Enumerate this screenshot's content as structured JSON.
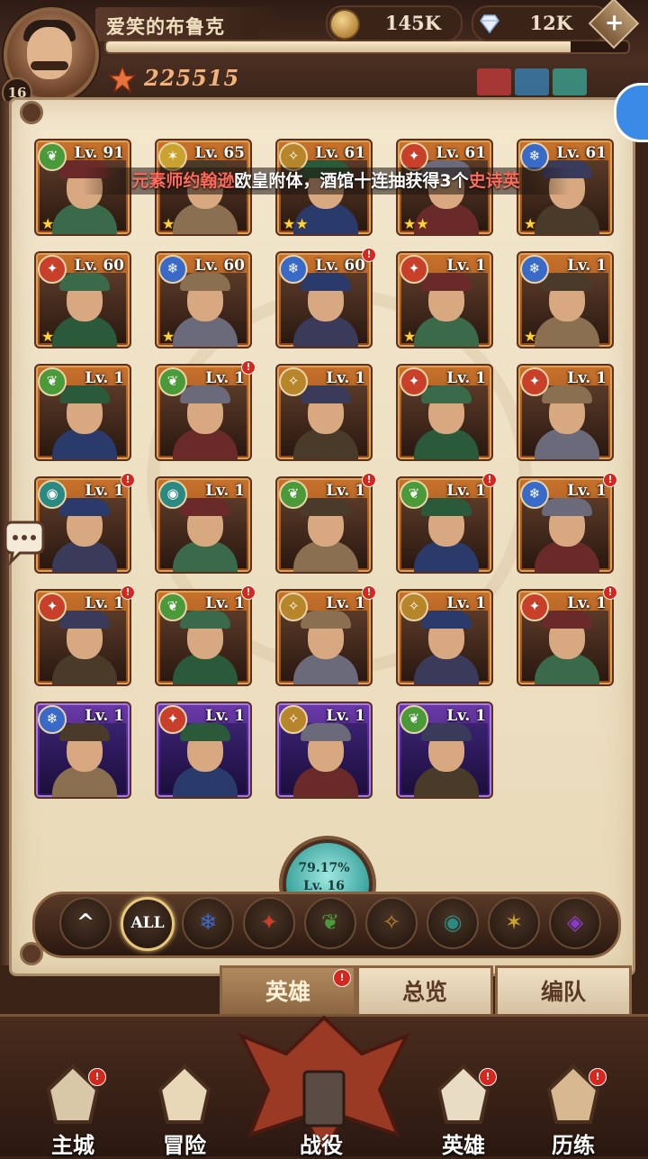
{
  "player": {
    "name": "爱笑的布鲁克",
    "level": "16",
    "xp_fraction": 0.89,
    "power": "225515"
  },
  "resources": {
    "gold": "145K",
    "gems": "12K",
    "plus": "+"
  },
  "banner": {
    "part1": "元素师约翰逊",
    "part2": "欧皇附体，酒馆十连抽获得3个",
    "part3": "史诗英"
  },
  "heroes": [
    {
      "lv": "Lv. 91",
      "elem": "nature",
      "stars": 1,
      "alert": false,
      "rare": false
    },
    {
      "lv": "Lv. 65",
      "elem": "light",
      "stars": 1,
      "alert": false,
      "rare": false
    },
    {
      "lv": "Lv. 61",
      "elem": "order",
      "stars": 2,
      "alert": false,
      "rare": false
    },
    {
      "lv": "Lv. 61",
      "elem": "fire",
      "stars": 2,
      "alert": false,
      "rare": false
    },
    {
      "lv": "Lv. 61",
      "elem": "ice",
      "stars": 1,
      "alert": false,
      "rare": false
    },
    {
      "lv": "Lv. 60",
      "elem": "fire",
      "stars": 1,
      "alert": false,
      "rare": false
    },
    {
      "lv": "Lv. 60",
      "elem": "ice",
      "stars": 1,
      "alert": false,
      "rare": false
    },
    {
      "lv": "Lv. 60",
      "elem": "ice",
      "stars": 0,
      "alert": true,
      "rare": false
    },
    {
      "lv": "Lv. 1",
      "elem": "fire",
      "stars": 1,
      "alert": false,
      "rare": false
    },
    {
      "lv": "Lv. 1",
      "elem": "ice",
      "stars": 1,
      "alert": false,
      "rare": false
    },
    {
      "lv": "Lv. 1",
      "elem": "nature",
      "stars": 0,
      "alert": false,
      "rare": false
    },
    {
      "lv": "Lv. 1",
      "elem": "nature",
      "stars": 0,
      "alert": true,
      "rare": false
    },
    {
      "lv": "Lv. 1",
      "elem": "order",
      "stars": 0,
      "alert": false,
      "rare": false
    },
    {
      "lv": "Lv. 1",
      "elem": "fire",
      "stars": 0,
      "alert": false,
      "rare": false
    },
    {
      "lv": "Lv. 1",
      "elem": "fire",
      "stars": 0,
      "alert": false,
      "rare": false
    },
    {
      "lv": "Lv. 1",
      "elem": "eye",
      "stars": 0,
      "alert": true,
      "rare": false
    },
    {
      "lv": "Lv. 1",
      "elem": "eye",
      "stars": 0,
      "alert": false,
      "rare": false
    },
    {
      "lv": "Lv. 1",
      "elem": "nature",
      "stars": 0,
      "alert": true,
      "rare": false
    },
    {
      "lv": "Lv. 1",
      "elem": "nature",
      "stars": 0,
      "alert": true,
      "rare": false
    },
    {
      "lv": "Lv. 1",
      "elem": "ice",
      "stars": 0,
      "alert": true,
      "rare": false
    },
    {
      "lv": "Lv. 1",
      "elem": "fire",
      "stars": 0,
      "alert": true,
      "rare": false
    },
    {
      "lv": "Lv. 1",
      "elem": "nature",
      "stars": 0,
      "alert": true,
      "rare": false
    },
    {
      "lv": "Lv. 1",
      "elem": "order",
      "stars": 0,
      "alert": true,
      "rare": false
    },
    {
      "lv": "Lv. 1",
      "elem": "order",
      "stars": 0,
      "alert": false,
      "rare": false
    },
    {
      "lv": "Lv. 1",
      "elem": "fire",
      "stars": 0,
      "alert": true,
      "rare": false
    },
    {
      "lv": "Lv. 1",
      "elem": "ice",
      "stars": 0,
      "alert": false,
      "rare": true
    },
    {
      "lv": "Lv. 1",
      "elem": "fire",
      "stars": 0,
      "alert": false,
      "rare": true
    },
    {
      "lv": "Lv. 1",
      "elem": "order",
      "stars": 0,
      "alert": false,
      "rare": true
    },
    {
      "lv": "Lv. 1",
      "elem": "nature",
      "stars": 0,
      "alert": false,
      "rare": true
    }
  ],
  "collection": {
    "percent": "79.17%",
    "level": "Lv. 16"
  },
  "filters": [
    {
      "label": "^",
      "icon": "collapse-icon"
    },
    {
      "label": "ALL",
      "icon": "all-filter-icon"
    },
    {
      "label": "",
      "icon": "ice-faction-icon"
    },
    {
      "label": "",
      "icon": "fire-faction-icon"
    },
    {
      "label": "",
      "icon": "nature-faction-icon"
    },
    {
      "label": "",
      "icon": "order-faction-icon"
    },
    {
      "label": "",
      "icon": "eye-faction-icon"
    },
    {
      "label": "",
      "icon": "light-faction-icon"
    },
    {
      "label": "",
      "icon": "void-faction-icon"
    }
  ],
  "tabs": [
    {
      "label": "英雄",
      "alert": true
    },
    {
      "label": "总览",
      "alert": false
    },
    {
      "label": "编队",
      "alert": false
    }
  ],
  "nav": [
    {
      "label": "主城",
      "alert": true,
      "icon": "castle-icon"
    },
    {
      "label": "冒险",
      "alert": false,
      "icon": "scroll-map-icon"
    },
    {
      "label": "战役",
      "alert": false,
      "icon": "dragon-icon"
    },
    {
      "label": "英雄",
      "alert": true,
      "icon": "hero-helmet-icon"
    },
    {
      "label": "历练",
      "alert": true,
      "icon": "wizard-hat-icon"
    }
  ],
  "colors": {
    "fire": "#c8402a",
    "ice": "#3a6ac8",
    "nature": "#4a9a3a",
    "order": "#b8862a",
    "eye": "#2a8a82",
    "light": "#caa230",
    "void": "#8a3ac8"
  }
}
